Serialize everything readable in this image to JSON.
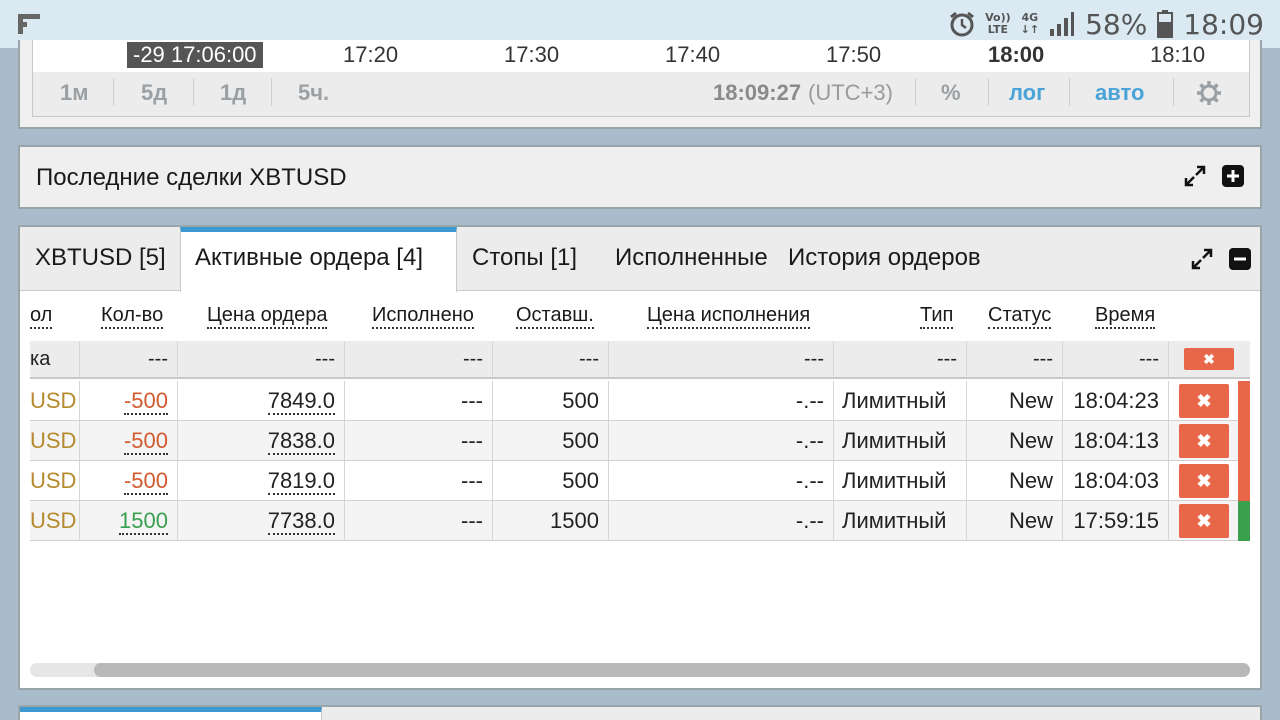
{
  "status_bar": {
    "network_top": "Vo))",
    "network_bottom": "LTE",
    "signal_top": "4G",
    "signal_bottom": "↓↑",
    "battery": "58%",
    "clock": "18:09"
  },
  "chart": {
    "cursor_time": "-29 17:06:00",
    "axis_times": [
      "17:20",
      "17:30",
      "17:40",
      "17:50",
      "18:00",
      "18:10"
    ],
    "ranges": [
      "1м",
      "5д",
      "1д",
      "5ч."
    ],
    "current_time": "18:09:27",
    "timezone": "(UTC+3)",
    "percent_label": "%",
    "log_label": "лог",
    "auto_label": "авто"
  },
  "trades_panel": {
    "title": "Последние сделки XBTUSD"
  },
  "orders_panel": {
    "tabs": [
      "XBTUSD [5]",
      "Активные ордера [4]",
      "Стопы [1]",
      "Исполненные",
      "История ордеров"
    ],
    "columns": [
      "ол",
      "Кол-во",
      "Цена ордера",
      "Исполнено",
      "Оставш.",
      "Цена исполнения",
      "Тип",
      "Статус",
      "Время"
    ],
    "filter_row": [
      "ка",
      "---",
      "---",
      "---",
      "---",
      "---",
      "---",
      "---",
      "---"
    ],
    "cancel_glyph": "✖",
    "rows": [
      {
        "symbol": "USD",
        "qty": "-500",
        "price": "7849.0",
        "filled": "---",
        "remaining": "500",
        "exec_price": "-.--",
        "type": "Лимитный",
        "status": "New",
        "time": "18:04:23"
      },
      {
        "symbol": "USD",
        "qty": "-500",
        "price": "7838.0",
        "filled": "---",
        "remaining": "500",
        "exec_price": "-.--",
        "type": "Лимитный",
        "status": "New",
        "time": "18:04:13"
      },
      {
        "symbol": "USD",
        "qty": "-500",
        "price": "7819.0",
        "filled": "---",
        "remaining": "500",
        "exec_price": "-.--",
        "type": "Лимитный",
        "status": "New",
        "time": "18:04:03"
      },
      {
        "symbol": "USD",
        "qty": "1500",
        "price": "7738.0",
        "filled": "---",
        "remaining": "1500",
        "exec_price": "-.--",
        "type": "Лимитный",
        "status": "New",
        "time": "17:59:15"
      }
    ]
  },
  "colors": {
    "accent": "#3d9ad1",
    "sell": "#d15b2e",
    "buy": "#3aa04e",
    "cancel": "#e8674a",
    "symbol": "#b6892f"
  },
  "icons": {
    "expand": "expand-arrows-icon",
    "plus": "plus-square-icon",
    "minus": "minus-square-icon",
    "gear": "gear-icon",
    "alarm": "alarm-clock-icon",
    "signal": "signal-bars-icon",
    "battery": "battery-icon"
  }
}
